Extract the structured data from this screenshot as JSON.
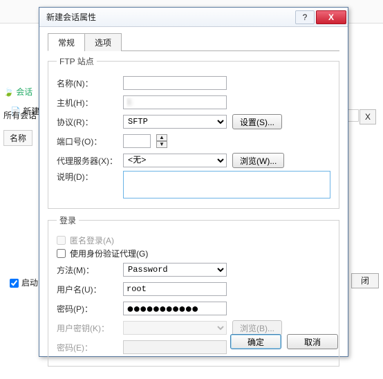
{
  "bg": {
    "session_tab": "会话",
    "new_tab": "新建",
    "all_sessions": "所有会话",
    "name_col": "名称",
    "startup": "启动",
    "close": "闭",
    "x": "X"
  },
  "dialog": {
    "title": "新建会话属性",
    "help": "?",
    "close": "X"
  },
  "tabs": {
    "general": "常规",
    "options": "选项"
  },
  "ftp": {
    "legend": "FTP 站点",
    "name_label": "名称(N)：",
    "name_value": "             ",
    "host_label": "主机(H)：",
    "host_value": "1           ",
    "protocol_label": "协议(R)：",
    "protocol_value": "SFTP",
    "settings_btn": "设置(S)...",
    "port_label": "端口号(O)：",
    "port_value": "  ",
    "proxy_label": "代理服务器(X)：",
    "proxy_value": "<无>",
    "browse_btn": "浏览(W)...",
    "desc_label": "说明(D)：",
    "desc_value": ""
  },
  "login": {
    "legend": "登录",
    "anon_label": "匿名登录(A)",
    "auth_proxy_label": "使用身份验证代理(G)",
    "method_label": "方法(M)：",
    "method_value": "Password",
    "user_label": "用户名(U)：",
    "user_value": "root",
    "pass_label": "密码(P)：",
    "pass_value": "●●●●●●●●●●●",
    "key_label": "用户密钥(K)：",
    "key_value": "",
    "key_browse": "浏览(B)...",
    "keypass_label": "密码(E)：",
    "keypass_value": ""
  },
  "footer": {
    "ok": "确定",
    "cancel": "取消"
  }
}
